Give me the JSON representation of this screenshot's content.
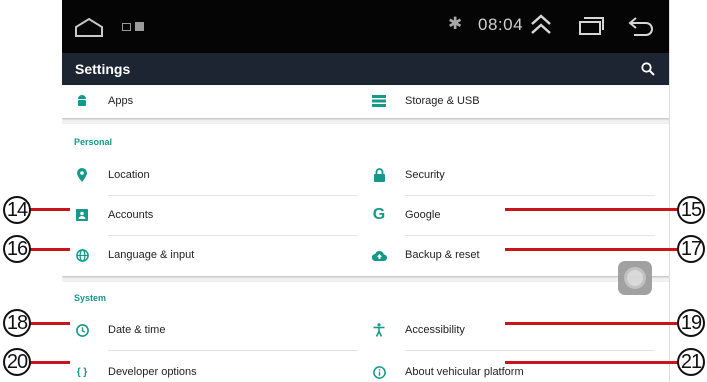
{
  "status_bar": {
    "time": "08:04",
    "bluetooth_glyph": "✱"
  },
  "app_bar": {
    "title": "Settings"
  },
  "top_items": [
    {
      "label": "Apps",
      "icon": "android-icon"
    },
    {
      "label": "Storage & USB",
      "icon": "storage-icon"
    }
  ],
  "personal": {
    "title": "Personal",
    "items": [
      {
        "label": "Location",
        "icon": "location-pin-icon"
      },
      {
        "label": "Security",
        "icon": "lock-icon"
      },
      {
        "label": "Accounts",
        "icon": "account-icon"
      },
      {
        "label": "Google",
        "icon": "google-icon",
        "glyph": "G"
      },
      {
        "label": "Language & input",
        "icon": "globe-icon"
      },
      {
        "label": "Backup & reset",
        "icon": "cloud-upload-icon"
      }
    ]
  },
  "system": {
    "title": "System",
    "items": [
      {
        "label": "Date & time",
        "icon": "clock-icon"
      },
      {
        "label": "Accessibility",
        "icon": "accessibility-icon"
      },
      {
        "label": "Developer options",
        "icon": "braces-icon",
        "glyph": "{ }"
      },
      {
        "label": "About vehicular platform",
        "icon": "info-icon"
      }
    ]
  },
  "callouts": [
    "14",
    "15",
    "16",
    "17",
    "18",
    "19",
    "20",
    "21"
  ],
  "colors": {
    "accent": "#16998a",
    "app_bar": "#1c2531",
    "status_bar": "#050505",
    "callout_line": "#c8141b"
  }
}
